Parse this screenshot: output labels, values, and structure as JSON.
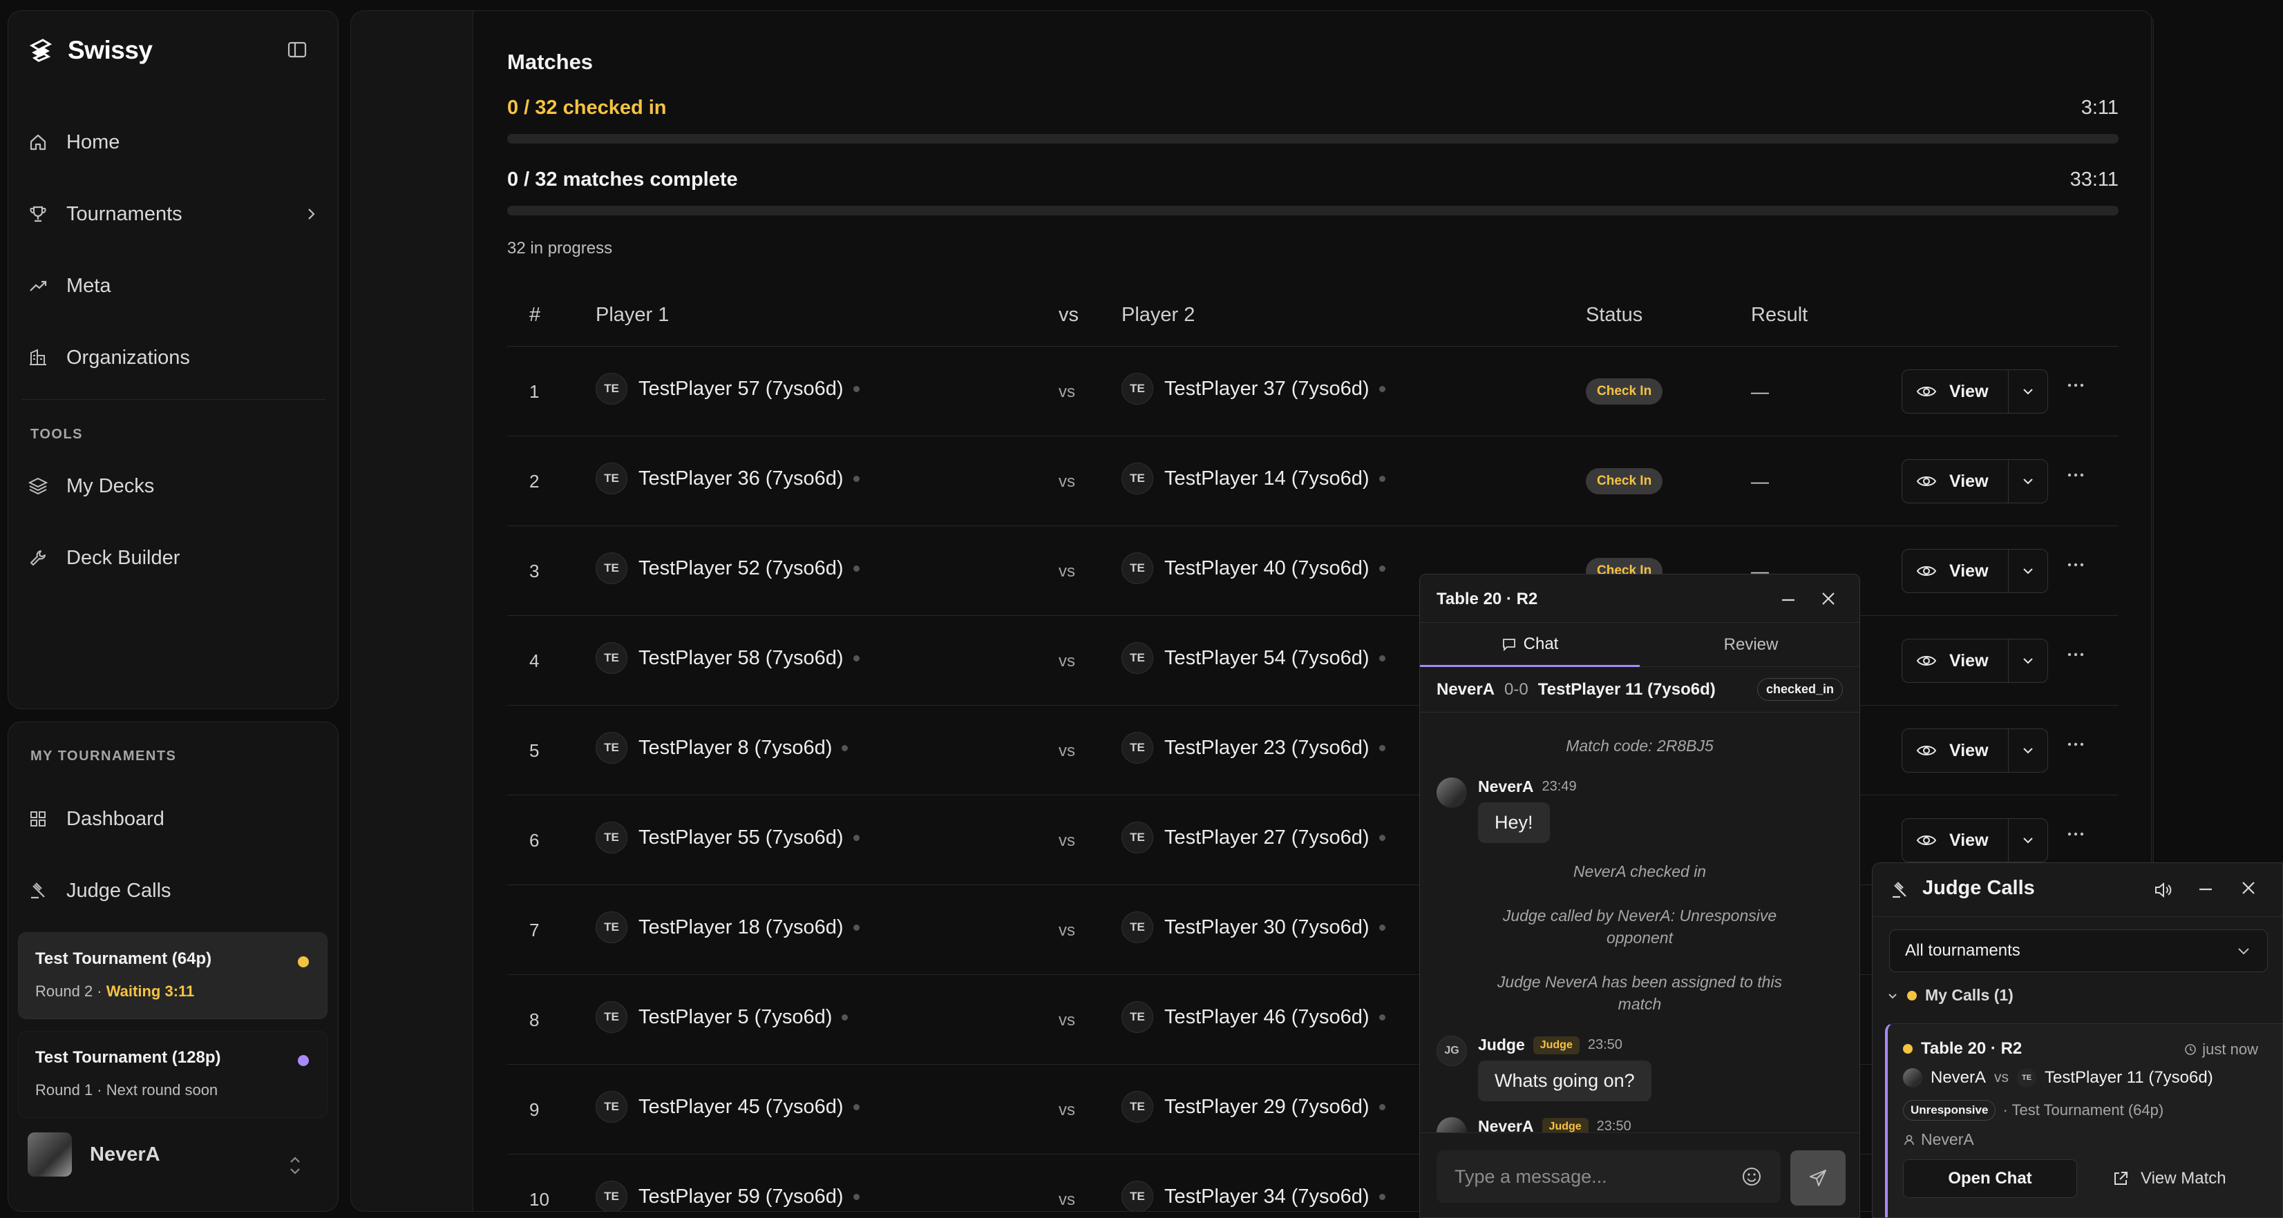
{
  "app": {
    "name": "Swissy"
  },
  "sidebar": {
    "nav": [
      {
        "label": "Home",
        "icon": "home-icon"
      },
      {
        "label": "Tournaments",
        "icon": "trophy-icon"
      },
      {
        "label": "Meta",
        "icon": "trend-icon"
      },
      {
        "label": "Organizations",
        "icon": "building-icon"
      }
    ],
    "tools_label": "TOOLS",
    "tools": [
      {
        "label": "My Decks",
        "icon": "layers-icon"
      },
      {
        "label": "Deck Builder",
        "icon": "wrench-icon"
      }
    ],
    "my_tournaments_label": "MY TOURNAMENTS",
    "my_nav": [
      {
        "label": "Dashboard",
        "icon": "grid-icon"
      },
      {
        "label": "Judge Calls",
        "icon": "gavel-icon"
      }
    ],
    "tournaments": [
      {
        "title": "Test Tournament (64p)",
        "sub_prefix": "Round 2 · ",
        "sub_highlight": "Waiting 3:11",
        "dot_color": "#f5c342"
      },
      {
        "title": "Test Tournament (128p)",
        "sub_prefix": "Round 1 · Next round soon",
        "sub_highlight": "",
        "dot_color": "#a78bfa"
      }
    ],
    "user": {
      "name": "NeverA"
    }
  },
  "matches": {
    "title": "Matches",
    "checked_in": "0 / 32 checked in",
    "checked_timer": "3:11",
    "checked_progress": 0,
    "complete": "0 / 32 matches complete",
    "complete_timer": "33:11",
    "complete_progress": 0,
    "in_progress": "32 in progress",
    "columns": {
      "num": "#",
      "p1": "Player 1",
      "vs": "vs",
      "p2": "Player 2",
      "status": "Status",
      "result": "Result"
    },
    "avatar_initials": "TE",
    "vs": "vs",
    "view_label": "View",
    "rows": [
      {
        "num": "1",
        "p1": "TestPlayer 57 (7yso6d)",
        "p2": "TestPlayer 37 (7yso6d)",
        "status": "Check In",
        "result": "—"
      },
      {
        "num": "2",
        "p1": "TestPlayer 36 (7yso6d)",
        "p2": "TestPlayer 14 (7yso6d)",
        "status": "Check In",
        "result": "—"
      },
      {
        "num": "3",
        "p1": "TestPlayer 52 (7yso6d)",
        "p2": "TestPlayer 40 (7yso6d)",
        "status": "Check In",
        "result": "—"
      },
      {
        "num": "4",
        "p1": "TestPlayer 58 (7yso6d)",
        "p2": "TestPlayer 54 (7yso6d)",
        "status": "",
        "result": ""
      },
      {
        "num": "5",
        "p1": "TestPlayer 8 (7yso6d)",
        "p2": "TestPlayer 23 (7yso6d)",
        "status": "",
        "result": ""
      },
      {
        "num": "6",
        "p1": "TestPlayer 55 (7yso6d)",
        "p2": "TestPlayer 27 (7yso6d)",
        "status": "",
        "result": ""
      },
      {
        "num": "7",
        "p1": "TestPlayer 18 (7yso6d)",
        "p2": "TestPlayer 30 (7yso6d)",
        "status": "",
        "result": ""
      },
      {
        "num": "8",
        "p1": "TestPlayer 5 (7yso6d)",
        "p2": "TestPlayer 46 (7yso6d)",
        "status": "",
        "result": ""
      },
      {
        "num": "9",
        "p1": "TestPlayer 45 (7yso6d)",
        "p2": "TestPlayer 29 (7yso6d)",
        "status": "",
        "result": ""
      },
      {
        "num": "10",
        "p1": "TestPlayer 59 (7yso6d)",
        "p2": "TestPlayer 34 (7yso6d)",
        "status": "",
        "result": ""
      }
    ]
  },
  "chat": {
    "title": "Table 20 · R2",
    "tabs": {
      "chat": "Chat",
      "review": "Review"
    },
    "match": {
      "p1": "NeverA",
      "score": "0-0",
      "p2": "TestPlayer 11 (7yso6d)",
      "state": "checked_in"
    },
    "match_code": "Match code: 2R8BJ5",
    "messages": {
      "m1": {
        "who": "NeverA",
        "time": "23:49",
        "text": "Hey!"
      },
      "sys1": "NeverA checked in",
      "sys2": "Judge called by NeverA: Unresponsive opponent",
      "sys3": "Judge NeverA has been assigned to this match",
      "m2": {
        "initials": "JG",
        "who": "Judge",
        "badge": "Judge",
        "time": "23:50",
        "text": "Whats going on?"
      },
      "m3": {
        "who": "NeverA",
        "badge": "Judge",
        "time": "23:50"
      }
    },
    "input_placeholder": "Type a message..."
  },
  "judge_calls": {
    "title": "Judge Calls",
    "filter": "All tournaments",
    "group": "My Calls (1)",
    "card": {
      "table": "Table 20 · R2",
      "ago": "just now",
      "p1": "NeverA",
      "vs": "vs",
      "p2_initials": "TE",
      "p2": "TestPlayer 11 (7yso6d)",
      "reason": "Unresponsive",
      "tournament": "· Test Tournament (64p)",
      "caller": "NeverA",
      "open_chat": "Open Chat",
      "view_match": "View Match"
    }
  },
  "colors": {
    "accent_yellow": "#f5c342",
    "accent_purple": "#a78bfa"
  }
}
